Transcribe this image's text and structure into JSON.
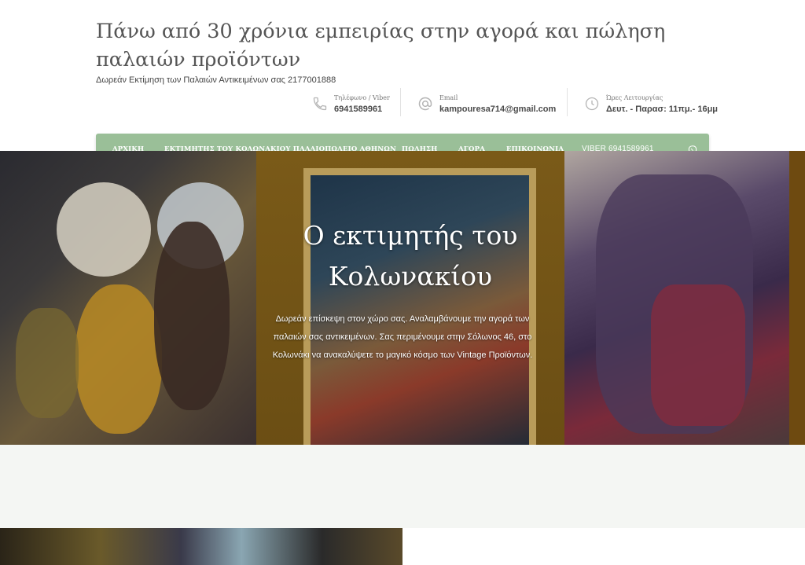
{
  "site": {
    "title": "Πάνω από 30 χρόνια εμπειρίας στην αγορά και πώληση παλαιών προϊόντων",
    "tagline": "Δωρεάν Εκτίμηση των Παλαιών Αντικειμένων σας 2177001888"
  },
  "contacts": [
    {
      "label": "Τηλέφωνο / Viber",
      "value": "6941589961",
      "icon": "phone-icon"
    },
    {
      "label": "Email",
      "value": "kampouresa714@gmail.com",
      "icon": "at-icon"
    },
    {
      "label": "Ώρες Λειτουργίας",
      "value": "Δευτ. - Παρασ: 11πμ.- 16μμ",
      "icon": "clock-icon"
    }
  ],
  "nav": {
    "items": [
      "ΑΡΧΙΚΗ",
      "ΕΚΤΙΜΗΤΗΣ ΤΟΥ ΚΟΛΩΝΑΚΙΟΥ ΠΑΛΑΙΟΠΩΛΕΙΟ ΑΘΗΝΩΝ",
      "ΠΩΛΗΣΗ",
      "ΑΓΟΡΑ",
      "ΕΠΙΚΟΙΝΩΝΙΑ",
      "VIBER 6941589961"
    ],
    "active": "ΑΡΧΙΚΗ",
    "icon": "viber-icon"
  },
  "hero": {
    "title_line1": "Ο εκτιμητής του",
    "title_line2": "Κολωνακίου",
    "text_line1": "Δωρεάν επίσκεψη στον χώρο σας. Αναλαμβάνουμε την αγορά των",
    "text_line2": "παλαιών σας αντικειμένων. Σας περιμένουμε στην Σόλωνος 46, στο",
    "text_line3": "Κολωνάκι να ανακαλύψετε το μαγικό κόσμο των Vintage Προϊόντων."
  },
  "colors": {
    "nav_bg": "#9abf98",
    "text": "#4a4a4a",
    "band": "#f4f6f3"
  }
}
